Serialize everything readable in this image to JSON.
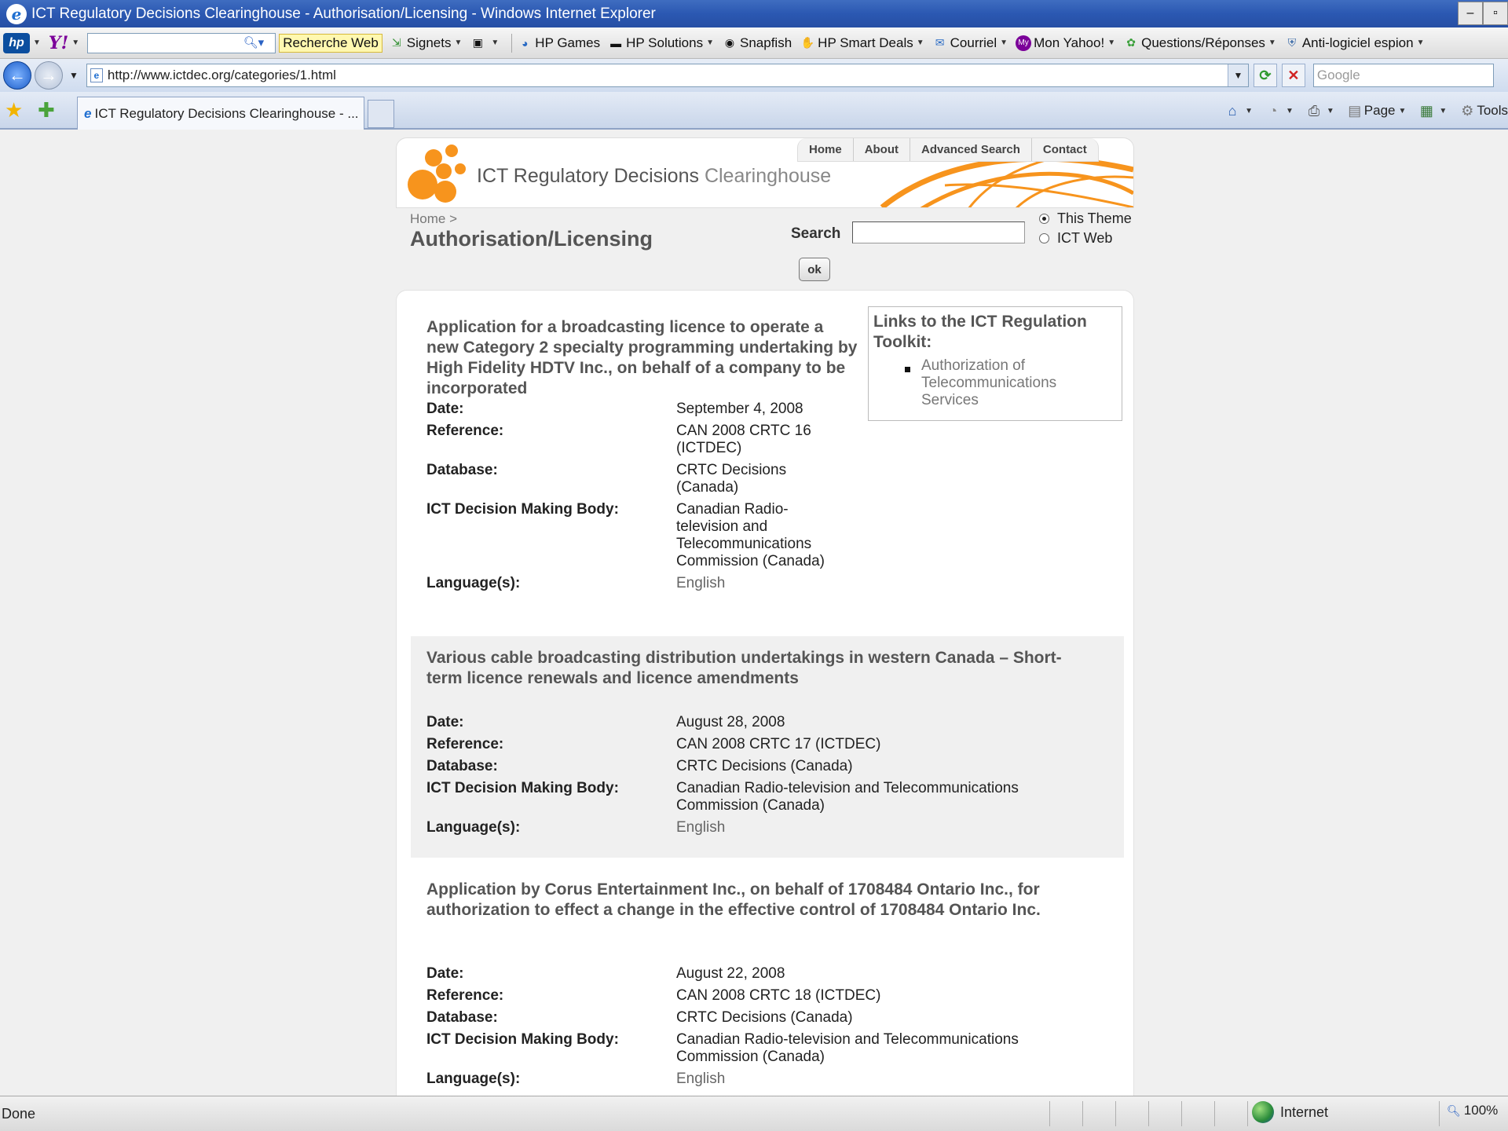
{
  "window": {
    "title": "ICT Regulatory Decisions Clearinghouse - Authorisation/Licensing - Windows Internet Explorer"
  },
  "yahoo_toolbar": {
    "search_button": "Recherche Web",
    "items": [
      "Signets",
      "HP Games",
      "HP Solutions",
      "Snapfish",
      "HP Smart Deals",
      "Courriel",
      "Mon Yahoo!",
      "Questions/Réponses",
      "Anti-logiciel espion"
    ]
  },
  "address_bar": {
    "url": "http://www.ictdec.org/categories/1.html",
    "search_placeholder": "Google"
  },
  "tabs": {
    "active_tab": "ICT Regulatory Decisions Clearinghouse - ..."
  },
  "command_bar": {
    "page_label": "Page",
    "tools_label": "Tools"
  },
  "site": {
    "title_main": "ICT Regulatory Decisions",
    "title_light": "Clearinghouse",
    "nav": [
      "Home",
      "About",
      "Advanced Search",
      "Contact"
    ],
    "breadcrumb": "Home >",
    "page_title": "Authorisation/Licensing",
    "search_label": "Search",
    "radio_this_theme": "This Theme",
    "radio_ict_web": "ICT Web",
    "ok_label": "ok"
  },
  "toolkit": {
    "title": "Links to the ICT Regulation Toolkit:",
    "link": "Authorization of Telecommunications Services"
  },
  "labels": {
    "date": "Date:",
    "reference": "Reference:",
    "database": "Database:",
    "body": "ICT Decision Making Body:",
    "language": "Language(s):"
  },
  "entries": [
    {
      "title": "Application for a broadcasting licence to operate a new Category 2 specialty programming undertaking by High Fidelity HDTV Inc., on behalf of a company to be incorporated",
      "date": "September 4, 2008",
      "reference": "CAN 2008 CRTC 16 (ICTDEC)",
      "database": "CRTC Decisions (Canada)",
      "body": "Canadian Radio-television and Telecommunications Commission (Canada)",
      "language": "English"
    },
    {
      "title": "Various cable broadcasting distribution undertakings in western Canada – Short-term licence renewals and licence amendments",
      "date": "August 28, 2008",
      "reference": "CAN 2008 CRTC 17 (ICTDEC)",
      "database": "CRTC Decisions (Canada)",
      "body": "Canadian Radio-television and Telecommunications Commission (Canada)",
      "language": "English"
    },
    {
      "title": "Application by Corus Entertainment Inc., on behalf of 1708484 Ontario Inc., for authorization to effect a change in the effective control of 1708484 Ontario Inc.",
      "date": "August 22, 2008",
      "reference": "CAN 2008 CRTC 18 (ICTDEC)",
      "database": "CRTC Decisions (Canada)",
      "body": "Canadian Radio-television and Telecommunications Commission (Canada)",
      "language": "English"
    }
  ],
  "status_bar": {
    "status": "Done",
    "zone": "Internet",
    "zoom": "100%"
  }
}
